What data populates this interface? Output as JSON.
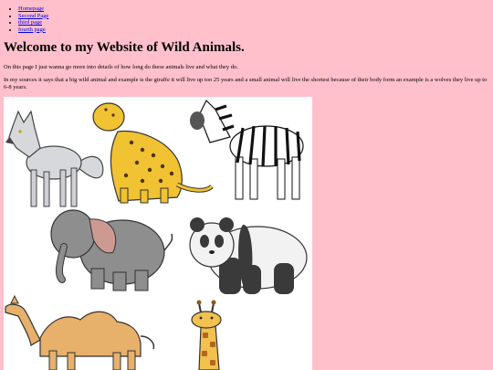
{
  "nav": {
    "items": [
      {
        "label": "Homepage"
      },
      {
        "label": "Second Page"
      },
      {
        "label": "third page"
      },
      {
        "label": "fourth page"
      }
    ]
  },
  "main": {
    "heading": "Welcome to my Website of Wild Animals.",
    "intro": "On this page I just wanna go more into details of how long do these animals live and what they do.",
    "body": "In my sources it says that a big wild animal and example is the giraffe it will live up too 25 years and a small animal will live the shortest because of their body form an example is a wolves they live up to 6-8 years."
  },
  "image": {
    "animals": [
      "wolf",
      "leopard",
      "zebra",
      "elephant",
      "panda",
      "camel",
      "giraffe"
    ]
  },
  "colors": {
    "background": "#ffc0cb",
    "link": "#0000ee"
  }
}
